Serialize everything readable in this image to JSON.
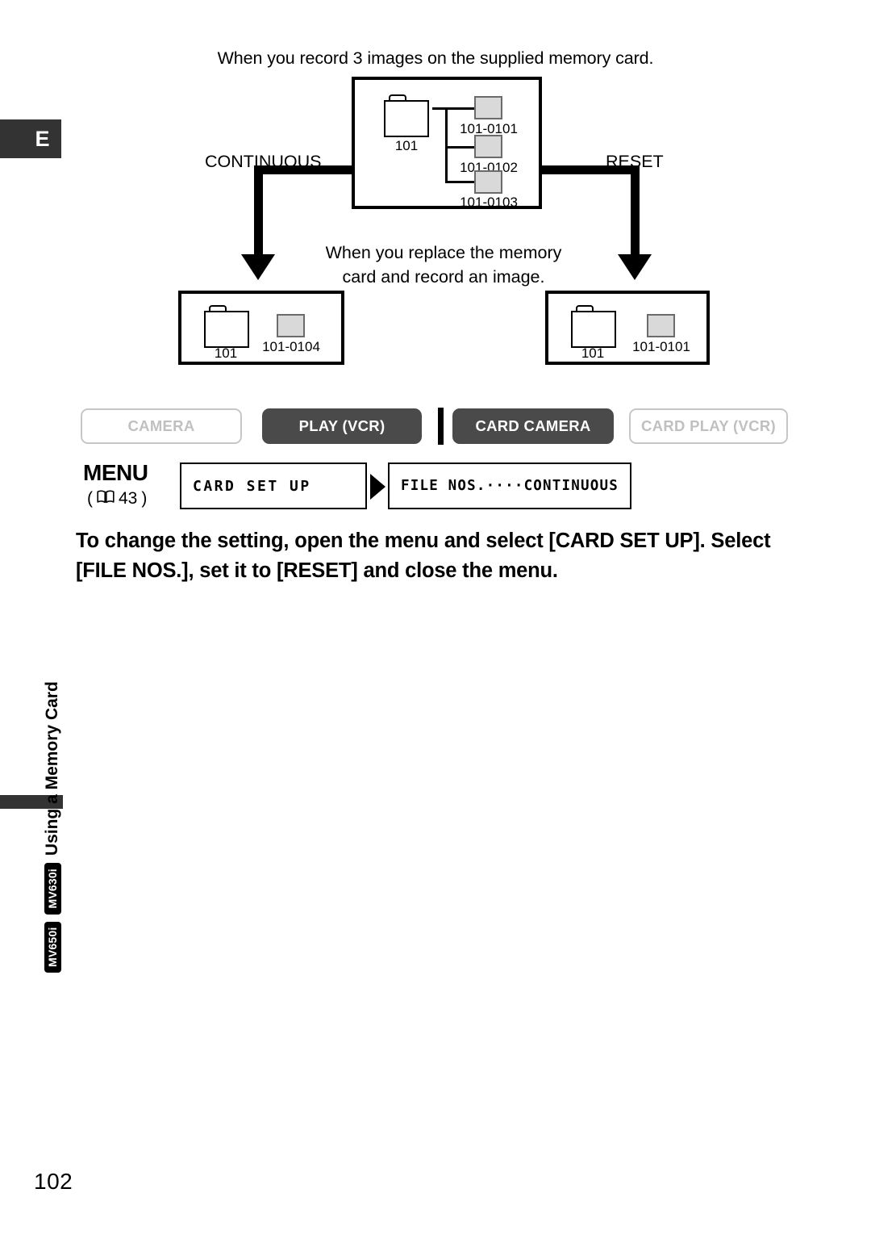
{
  "page": {
    "language_tab": "E",
    "page_number": "102",
    "running_head": {
      "title": "Using a Memory Card",
      "model_badges": [
        "MV650i",
        "MV630i"
      ]
    }
  },
  "diagram": {
    "caption_top": "When you record 3 images on the supplied memory card.",
    "caption_mid_line1": "When you replace the memory",
    "caption_mid_line2": "card and record an image.",
    "branch_left_label": "CONTINUOUS",
    "branch_right_label": "RESET",
    "main_card": {
      "folder_label": "101",
      "files": [
        "101-0101",
        "101-0102",
        "101-0103"
      ]
    },
    "result_continuous": {
      "folder_label": "101",
      "files": [
        "101-0104"
      ]
    },
    "result_reset": {
      "folder_label": "101",
      "files": [
        "101-0101"
      ]
    },
    "icons": {
      "folder": "folder-icon",
      "file": "image-file-icon",
      "arrow": "down-arrow-icon"
    }
  },
  "modes": {
    "items": [
      {
        "label": "CAMERA",
        "state": "inactive"
      },
      {
        "label": "PLAY (VCR)",
        "state": "active"
      },
      {
        "label": "CARD CAMERA",
        "state": "active"
      },
      {
        "label": "CARD PLAY (VCR)",
        "state": "inactive"
      }
    ]
  },
  "menu": {
    "label": "MENU",
    "reference_prefix": "(",
    "reference_page": "43",
    "reference_suffix": ")",
    "book_icon": "book-icon",
    "lcd_left": "CARD SET UP",
    "lcd_right": "FILE NOS.····CONTINUOUS",
    "arrow_icon": "play-arrow-icon"
  },
  "instruction": {
    "text": "To change the setting, open the menu and select [CARD SET UP]. Select [FILE NOS.], set it to [RESET] and close the menu."
  },
  "colors": {
    "tab_dark": "#333333",
    "pill_active": "#4a4a4a",
    "pill_inactive_border": "#c6c6c6",
    "pill_inactive_text": "#c0c0c0",
    "file_fill": "#d9d9d9"
  }
}
